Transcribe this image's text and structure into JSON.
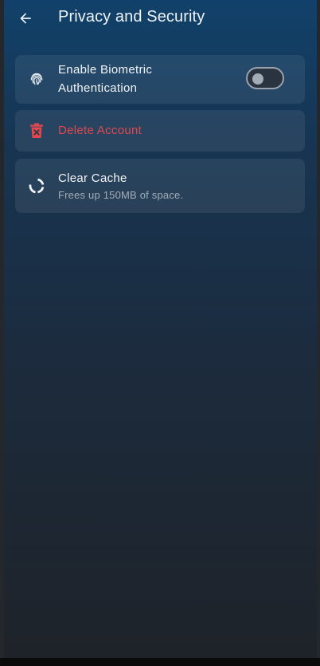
{
  "header": {
    "title": "Privacy and Security",
    "back_icon": "arrow-left-icon"
  },
  "settings": {
    "biometric": {
      "label_line1": "Enable Biometric",
      "label_line2": "Authentication",
      "icon": "fingerprint-icon",
      "enabled": false
    },
    "delete_account": {
      "label": "Delete Account",
      "icon": "delete-bin-icon",
      "color": "#e0484f"
    },
    "clear_cache": {
      "label": "Clear Cache",
      "subtitle": "Frees up 150MB of space.",
      "icon": "circular-progress-icon"
    }
  },
  "colors": {
    "gradient_top": "#11416a",
    "gradient_bottom": "#1e2329",
    "danger": "#e0484f"
  }
}
